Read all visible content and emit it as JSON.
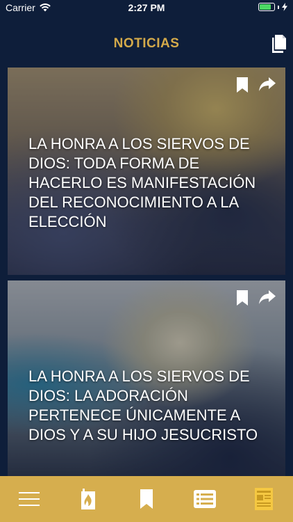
{
  "status_bar": {
    "carrier": "Carrier",
    "time": "2:27 PM",
    "battery_level": 0.8
  },
  "nav": {
    "title": "NOTICIAS",
    "document_icon": "document-icon"
  },
  "feed": {
    "items": [
      {
        "title": "LA HONRA A LOS SIERVOS DE DIOS: TODA FORMA DE HACERLO ES MANIFESTACIÓN DEL RECONOCIMIENTO A LA ELECCIÓN",
        "bookmark_icon": "bookmark-icon",
        "share_icon": "share-icon"
      },
      {
        "title": "LA HONRA A LOS SIERVOS DE DIOS: LA ADORACIÓN PERTENECE ÚNICAMENTE A DIOS Y A SU HIJO JESUCRISTO",
        "bookmark_icon": "bookmark-icon",
        "share_icon": "share-icon"
      }
    ]
  },
  "tab_bar": {
    "tabs": [
      "menu-icon",
      "flame-icon",
      "bookmark-icon",
      "list-icon",
      "news-icon"
    ],
    "active_index": 4
  },
  "colors": {
    "background": "#0e1e3a",
    "accent_gold": "#d4aa4a",
    "tab_bar": "#d6ae4e",
    "active_tab": "#f5c842"
  }
}
